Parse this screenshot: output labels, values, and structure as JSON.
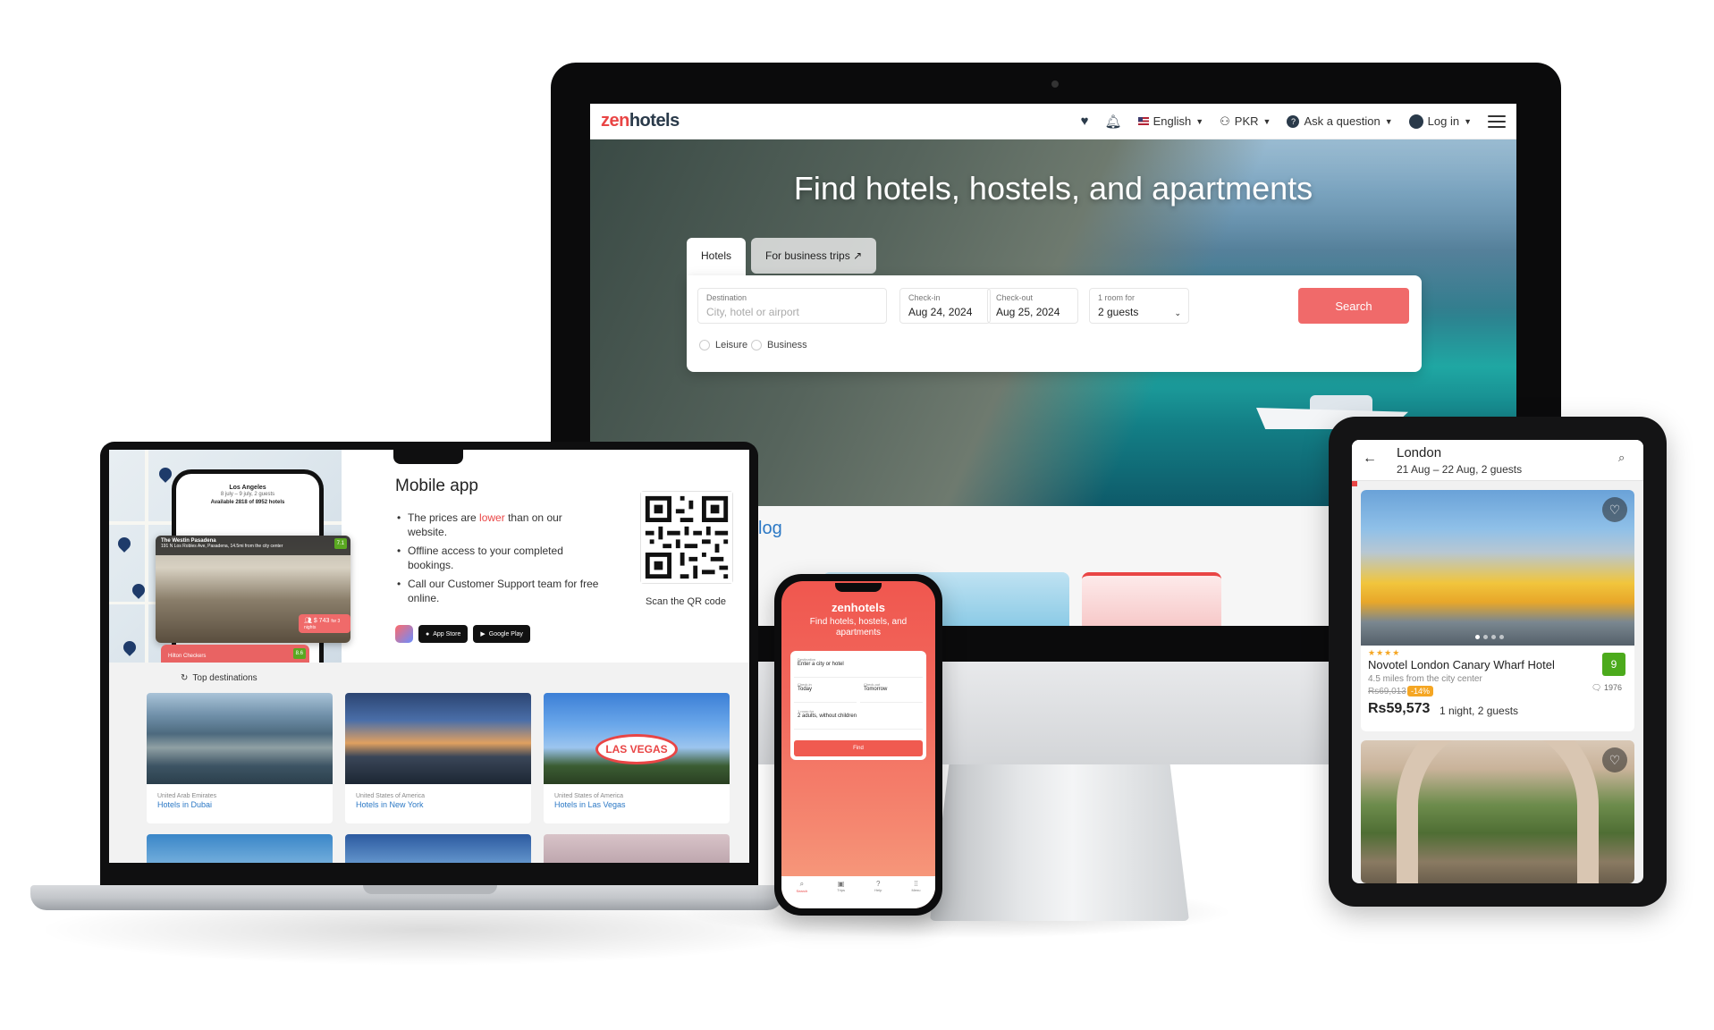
{
  "desktop": {
    "logo_zen": "zen",
    "logo_hotels": "hotels",
    "nav": {
      "language": "English",
      "currency": "PKR",
      "ask": "Ask a question",
      "login": "Log in"
    },
    "hero_title": "Find hotels, hostels, and apartments",
    "tabs": {
      "hotels": "Hotels",
      "business": "For business trips"
    },
    "search": {
      "destination_label": "Destination",
      "destination_placeholder": "City, hotel or airport",
      "checkin_label": "Check-in",
      "checkin_value": "Aug 24, 2024",
      "checkout_label": "Check-out",
      "checkout_value": "Aug 25, 2024",
      "rooms_label": "1 room for",
      "guests_value": "2 guests",
      "button": "Search",
      "purpose_leisure": "Leisure",
      "purpose_business": "Business"
    },
    "blog_heading": "log"
  },
  "laptop": {
    "phone_city": "Los Angeles",
    "phone_dates": "8 july – 9 july, 2 guests",
    "phone_avail": "Available 2818 of 8952 hotels",
    "card_hotel": "The Westin Pasadena",
    "card_address": "191 N Los Robles Ave, Pasadena, 14.5mi from the city center",
    "card_score": "7.1",
    "card_price": "$ 743",
    "card_price_note": "for 3 nights",
    "card2_hotel": "Hilton Checkers",
    "card2_score": "8.6",
    "app_title": "Mobile app",
    "bullets": {
      "b1_pre": "The prices are ",
      "b1_red": "lower",
      "b1_post": " than on our website.",
      "b2": "Offline access to your completed bookings.",
      "b3": "Call our Customer Support team for free online."
    },
    "store_apple": "App Store",
    "store_google": "Google Play",
    "qr_label": "Scan the QR code",
    "top_destinations": "Top destinations",
    "destinations": [
      {
        "country": "United Arab Emirates",
        "title": "Hotels in Dubai"
      },
      {
        "country": "United States of America",
        "title": "Hotels in New York"
      },
      {
        "country": "United States of America",
        "title": "Hotels in Las Vegas"
      }
    ],
    "lv_sign": "LAS VEGAS"
  },
  "phone": {
    "logo": "zenhotels",
    "tagline": "Find hotels, hostels, and apartments",
    "destination_label": "Destination",
    "destination_value": "Enter a city or hotel",
    "checkin_label": "Check-in",
    "checkin_value": "Today",
    "checkout_label": "Check-out",
    "checkout_value": "Tomorrow",
    "rooms_label": "1 room for",
    "guests_value": "2 adults, without children",
    "find": "Find",
    "tabs": [
      "Search",
      "Trips",
      "Help",
      "Menu"
    ]
  },
  "tablet": {
    "city": "London",
    "dates": "21 Aug – 22 Aug, 2 guests",
    "hotel_name": "Novotel London Canary Wharf Hotel",
    "stars": "★★★★",
    "score": "9",
    "distance": "4.5 miles from the city center",
    "reviews": "1976",
    "old_price": "Rs69,013",
    "discount": "-14%",
    "price": "Rs59,573",
    "price_note": "1 night, 2 guests"
  }
}
